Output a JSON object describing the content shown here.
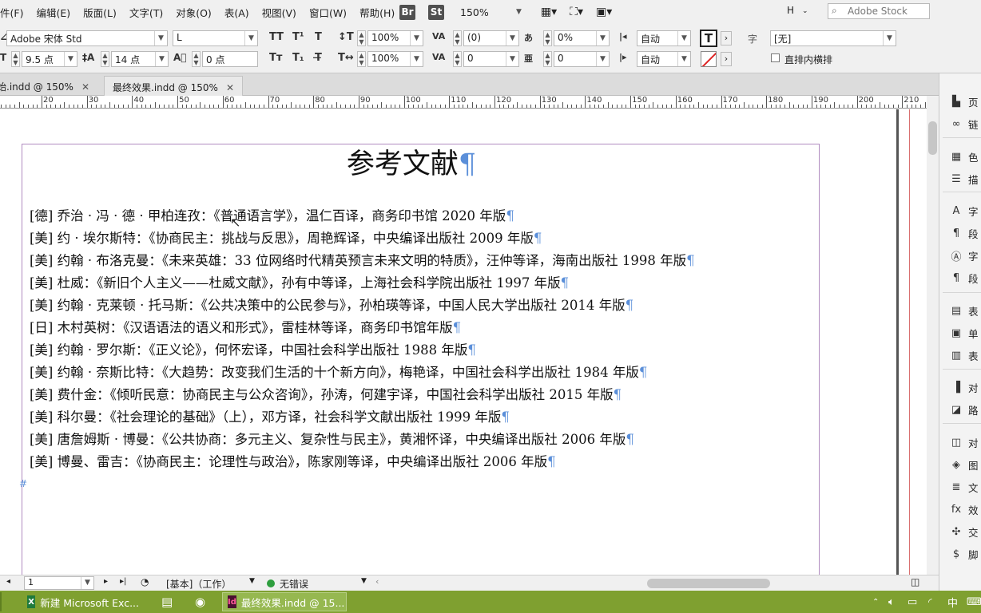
{
  "menubar": {
    "items": [
      "件(F)",
      "编辑(E)",
      "版面(L)",
      "文字(T)",
      "对象(O)",
      "表(A)",
      "视图(V)",
      "窗口(W)",
      "帮助(H)"
    ],
    "bridge": "Br",
    "stock_btn": "St",
    "zoom": "150%",
    "workspace": "H",
    "search_placeholder": "Adobe Stock"
  },
  "control": {
    "font_family": "Adobe 宋体 Std",
    "font_style": "L",
    "font_size": "9.5 点",
    "leading": "14 点",
    "tracking_pts": "0 点",
    "vscale": "100%",
    "hscale": "100%",
    "kerning": "(0)",
    "tracking": "0",
    "baseline": "0%",
    "skew": "0",
    "auto1": "自动",
    "auto2": "自动",
    "char_label": "字",
    "char_style": "[无]",
    "vertical_checkbox": "直排内横排"
  },
  "tabs": [
    {
      "label": "始.indd @ 150%",
      "active": false
    },
    {
      "label": "最终效果.indd @ 150%",
      "active": true
    }
  ],
  "ruler": [
    20,
    30,
    40,
    50,
    60,
    70,
    80,
    90,
    100,
    110,
    120,
    130,
    140,
    150,
    160,
    170,
    180,
    190,
    200,
    210
  ],
  "document": {
    "title": "参考文献",
    "pilcrow": "¶",
    "references": [
      "[德] 乔治 · 冯 · 德 · 甲柏连孜：《普通语言学》，温仁百译，商务印书馆 2020 年版",
      "[美] 约 · 埃尔斯特：《协商民主：挑战与反思》，周艳辉译，中央编译出版社 2009 年版",
      "[美] 约翰 · 布洛克曼：《未来英雄：33 位网络时代精英预言未来文明的特质》，汪仲等译，海南出版社 1998 年版",
      "[美] 杜威：《新旧个人主义——杜威文献》，孙有中等译，上海社会科学院出版社 1997 年版",
      "[美] 约翰 · 克莱顿 · 托马斯：《公共决策中的公民参与》，孙柏瑛等译，中国人民大学出版社 2014 年版",
      "[日] 木村英树：《汉语语法的语义和形式》，雷桂林等译，商务印书馆年版",
      "[美] 约翰 · 罗尔斯：《正义论》，何怀宏译，中国社会科学出版社 1988 年版",
      "[美] 约翰 · 奈斯比特：《大趋势：改变我们生活的十个新方向》，梅艳译，中国社会科学出版社 1984 年版",
      "[美] 费什金：《倾听民意：协商民主与公众咨询》，孙涛，何建宇译，中国社会科学出版社 2015 年版",
      "[美] 科尔曼：《社会理论的基础》（上），邓方译，社会科学文献出版社 1999 年版",
      "[美] 唐詹姆斯 · 博曼：《公共协商：多元主义、复杂性与民主》，黄湘怀译，中央编译出版社 2006 年版",
      "[美] 博曼、雷吉：《协商民主：论理性与政治》，陈家刚等译，中央编译出版社 2006 年版"
    ],
    "end_marker": "#"
  },
  "status": {
    "page": "1",
    "style": "[基本]（工作）",
    "preflight": "无错误",
    "preflight_color": "#2e9e3e"
  },
  "panels": [
    {
      "icon": "pages-icon",
      "glyph": "▙",
      "label": "页"
    },
    {
      "icon": "links-icon",
      "glyph": "∞",
      "label": "链"
    },
    {
      "icon": "swatches-icon",
      "glyph": "▦",
      "label": "色"
    },
    {
      "icon": "stroke-icon",
      "glyph": "☰",
      "label": "描"
    },
    {
      "icon": "character-icon",
      "glyph": "A",
      "label": "字"
    },
    {
      "icon": "paragraph-icon",
      "glyph": "¶",
      "label": "段"
    },
    {
      "icon": "char-styles-icon",
      "glyph": "Ⓐ",
      "label": "字"
    },
    {
      "icon": "para-styles-icon",
      "glyph": "¶",
      "label": "段"
    },
    {
      "icon": "table-icon",
      "glyph": "▤",
      "label": "表"
    },
    {
      "icon": "cell-styles-icon",
      "glyph": "▣",
      "label": "单"
    },
    {
      "icon": "table-styles-icon",
      "glyph": "▥",
      "label": "表"
    },
    {
      "icon": "align-icon",
      "glyph": "▐",
      "label": "对"
    },
    {
      "icon": "pathfinder-icon",
      "glyph": "◪",
      "label": "路"
    },
    {
      "icon": "object-styles-icon",
      "glyph": "◫",
      "label": "对"
    },
    {
      "icon": "layers-icon",
      "glyph": "◈",
      "label": "图"
    },
    {
      "icon": "text-wrap-icon",
      "glyph": "≣",
      "label": "文"
    },
    {
      "icon": "effects-icon",
      "glyph": "fx",
      "label": "效"
    },
    {
      "icon": "interactive-icon",
      "glyph": "✣",
      "label": "交"
    },
    {
      "icon": "scripts-icon",
      "glyph": "$",
      "label": "脚"
    }
  ],
  "taskbar": {
    "excel": "新建 Microsoft Exc...",
    "indesign": "最终效果.indd @ 15...",
    "ime": "中"
  }
}
